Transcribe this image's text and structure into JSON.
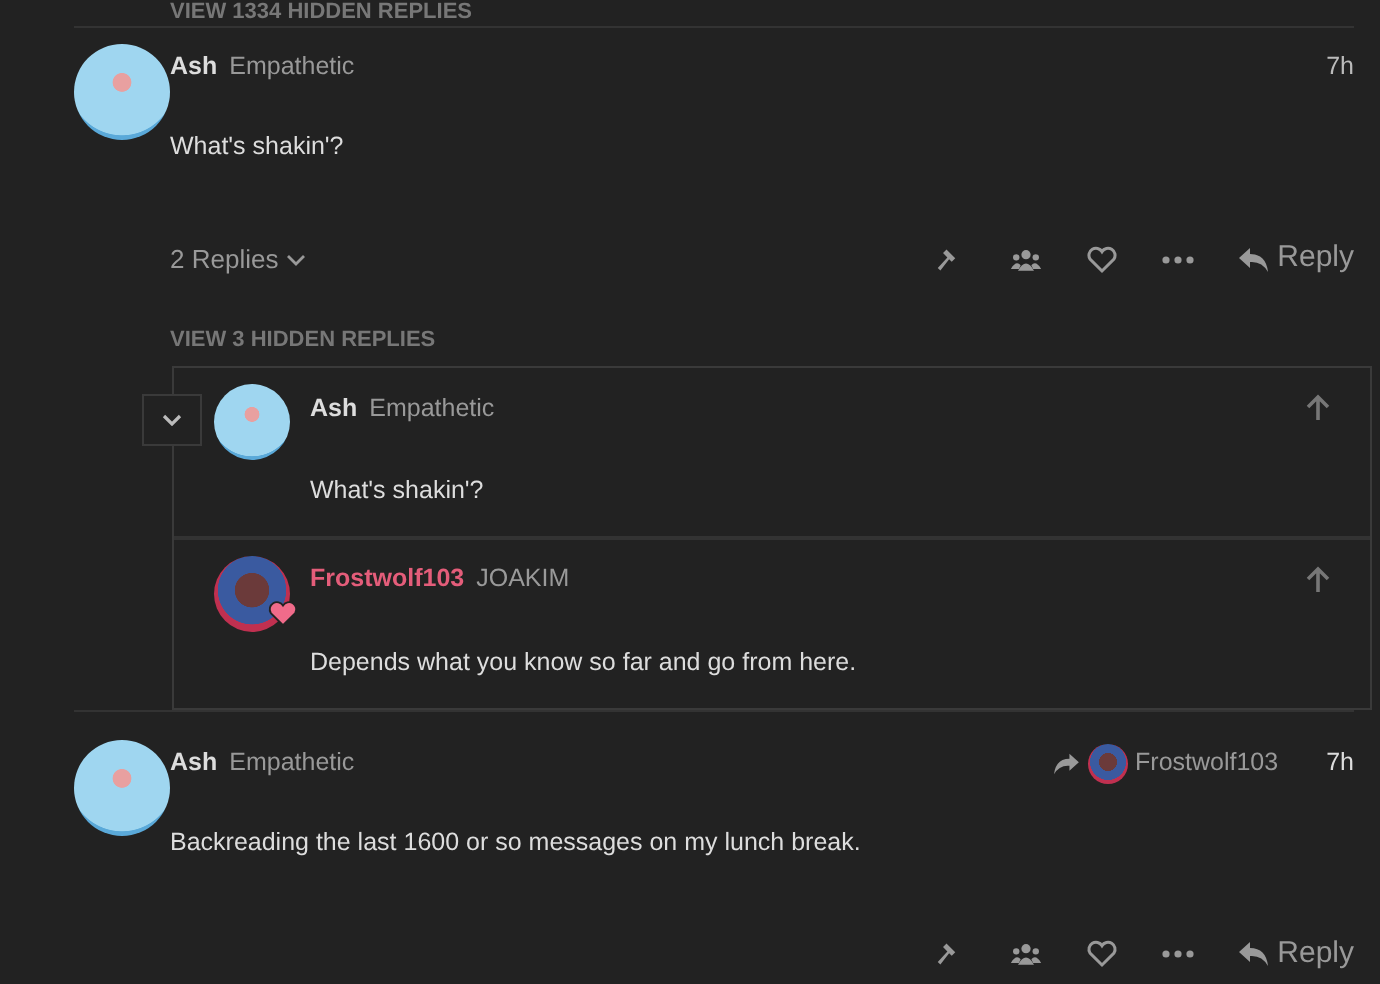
{
  "hidden_replies_top": "VIEW 1334 HIDDEN REPLIES",
  "posts": [
    {
      "username": "Ash",
      "color": "#dddddd",
      "title": "Empathetic",
      "time": "7h",
      "body": "What's shakin'?",
      "replies_toggle": "2 Replies",
      "reply_label": "Reply",
      "view_hidden": "VIEW 3 HIDDEN REPLIES",
      "embedded": [
        {
          "username": "Ash",
          "color": "#dddddd",
          "title": "Empathetic",
          "body": "What's shakin'?",
          "flair": false
        },
        {
          "username": "Frostwolf103",
          "color": "#e45d7a",
          "title": "JOAKIM",
          "body": "Depends what you know so far and go from here.",
          "flair": true
        }
      ]
    },
    {
      "username": "Ash",
      "color": "#dddddd",
      "title": "Empathetic",
      "time": "7h",
      "body": "Backreading the last 1600 or so messages on my lunch break.",
      "reply_to": "Frostwolf103",
      "reply_label": "Reply"
    }
  ]
}
